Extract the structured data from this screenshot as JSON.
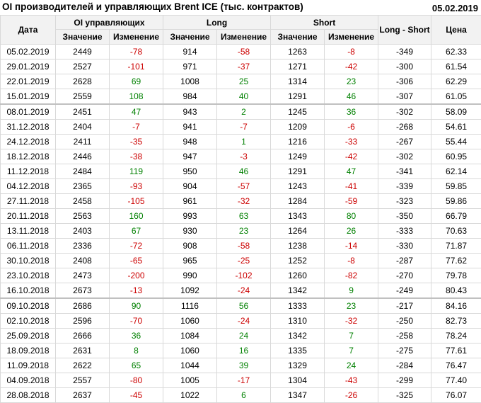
{
  "title": "OI производителей и управляющих Brent ICE (тыс. контрактов)",
  "report_date": "05.02.2019",
  "headers": {
    "date": "Дата",
    "oi": "OI управляющих",
    "long": "Long",
    "short": "Short",
    "long_short": "Long - Short",
    "price": "Цена",
    "value": "Значение",
    "change": "Изменение"
  },
  "colors": {
    "negative": "#cc0000",
    "positive": "#008000",
    "header_bg": "#f2f2f2",
    "grid": "#d9d9d9"
  },
  "rows": [
    {
      "date": "05.02.2019",
      "oi": "2449",
      "oi_chg": "-78",
      "long": "914",
      "long_chg": "-58",
      "short": "1263",
      "short_chg": "-8",
      "ls": "-349",
      "price": "62.33"
    },
    {
      "date": "29.01.2019",
      "oi": "2527",
      "oi_chg": "-101",
      "long": "971",
      "long_chg": "-37",
      "short": "1271",
      "short_chg": "-42",
      "ls": "-300",
      "price": "61.54"
    },
    {
      "date": "22.01.2019",
      "oi": "2628",
      "oi_chg": "69",
      "long": "1008",
      "long_chg": "25",
      "short": "1314",
      "short_chg": "23",
      "ls": "-306",
      "price": "62.29"
    },
    {
      "date": "15.01.2019",
      "oi": "2559",
      "oi_chg": "108",
      "long": "984",
      "long_chg": "40",
      "short": "1291",
      "short_chg": "46",
      "ls": "-307",
      "price": "61.05"
    },
    {
      "date": "08.01.2019",
      "oi": "2451",
      "oi_chg": "47",
      "long": "943",
      "long_chg": "2",
      "short": "1245",
      "short_chg": "36",
      "ls": "-302",
      "price": "58.09"
    },
    {
      "date": "31.12.2018",
      "oi": "2404",
      "oi_chg": "-7",
      "long": "941",
      "long_chg": "-7",
      "short": "1209",
      "short_chg": "-6",
      "ls": "-268",
      "price": "54.61"
    },
    {
      "date": "24.12.2018",
      "oi": "2411",
      "oi_chg": "-35",
      "long": "948",
      "long_chg": "1",
      "short": "1216",
      "short_chg": "-33",
      "ls": "-267",
      "price": "55.44"
    },
    {
      "date": "18.12.2018",
      "oi": "2446",
      "oi_chg": "-38",
      "long": "947",
      "long_chg": "-3",
      "short": "1249",
      "short_chg": "-42",
      "ls": "-302",
      "price": "60.95"
    },
    {
      "date": "11.12.2018",
      "oi": "2484",
      "oi_chg": "119",
      "long": "950",
      "long_chg": "46",
      "short": "1291",
      "short_chg": "47",
      "ls": "-341",
      "price": "62.14"
    },
    {
      "date": "04.12.2018",
      "oi": "2365",
      "oi_chg": "-93",
      "long": "904",
      "long_chg": "-57",
      "short": "1243",
      "short_chg": "-41",
      "ls": "-339",
      "price": "59.85"
    },
    {
      "date": "27.11.2018",
      "oi": "2458",
      "oi_chg": "-105",
      "long": "961",
      "long_chg": "-32",
      "short": "1284",
      "short_chg": "-59",
      "ls": "-323",
      "price": "59.86"
    },
    {
      "date": "20.11.2018",
      "oi": "2563",
      "oi_chg": "160",
      "long": "993",
      "long_chg": "63",
      "short": "1343",
      "short_chg": "80",
      "ls": "-350",
      "price": "66.79"
    },
    {
      "date": "13.11.2018",
      "oi": "2403",
      "oi_chg": "67",
      "long": "930",
      "long_chg": "23",
      "short": "1264",
      "short_chg": "26",
      "ls": "-333",
      "price": "70.63"
    },
    {
      "date": "06.11.2018",
      "oi": "2336",
      "oi_chg": "-72",
      "long": "908",
      "long_chg": "-58",
      "short": "1238",
      "short_chg": "-14",
      "ls": "-330",
      "price": "71.87"
    },
    {
      "date": "30.10.2018",
      "oi": "2408",
      "oi_chg": "-65",
      "long": "965",
      "long_chg": "-25",
      "short": "1252",
      "short_chg": "-8",
      "ls": "-287",
      "price": "77.62"
    },
    {
      "date": "23.10.2018",
      "oi": "2473",
      "oi_chg": "-200",
      "long": "990",
      "long_chg": "-102",
      "short": "1260",
      "short_chg": "-82",
      "ls": "-270",
      "price": "79.78"
    },
    {
      "date": "16.10.2018",
      "oi": "2673",
      "oi_chg": "-13",
      "long": "1092",
      "long_chg": "-24",
      "short": "1342",
      "short_chg": "9",
      "ls": "-249",
      "price": "80.43"
    },
    {
      "date": "09.10.2018",
      "oi": "2686",
      "oi_chg": "90",
      "long": "1116",
      "long_chg": "56",
      "short": "1333",
      "short_chg": "23",
      "ls": "-217",
      "price": "84.16"
    },
    {
      "date": "02.10.2018",
      "oi": "2596",
      "oi_chg": "-70",
      "long": "1060",
      "long_chg": "-24",
      "short": "1310",
      "short_chg": "-32",
      "ls": "-250",
      "price": "82.73"
    },
    {
      "date": "25.09.2018",
      "oi": "2666",
      "oi_chg": "36",
      "long": "1084",
      "long_chg": "24",
      "short": "1342",
      "short_chg": "7",
      "ls": "-258",
      "price": "78.24"
    },
    {
      "date": "18.09.2018",
      "oi": "2631",
      "oi_chg": "8",
      "long": "1060",
      "long_chg": "16",
      "short": "1335",
      "short_chg": "7",
      "ls": "-275",
      "price": "77.61"
    },
    {
      "date": "11.09.2018",
      "oi": "2622",
      "oi_chg": "65",
      "long": "1044",
      "long_chg": "39",
      "short": "1329",
      "short_chg": "24",
      "ls": "-284",
      "price": "76.47"
    },
    {
      "date": "04.09.2018",
      "oi": "2557",
      "oi_chg": "-80",
      "long": "1005",
      "long_chg": "-17",
      "short": "1304",
      "short_chg": "-43",
      "ls": "-299",
      "price": "77.40"
    },
    {
      "date": "28.08.2018",
      "oi": "2637",
      "oi_chg": "-45",
      "long": "1022",
      "long_chg": "6",
      "short": "1347",
      "short_chg": "-26",
      "ls": "-325",
      "price": "76.07"
    }
  ]
}
